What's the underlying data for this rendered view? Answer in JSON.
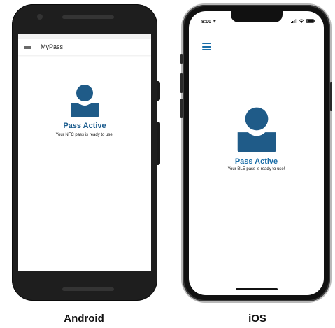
{
  "android": {
    "app_title": "MyPass",
    "pass_title": "Pass Active",
    "pass_subtitle": "Your NFC pass is ready to use!",
    "caption": "Android"
  },
  "ios": {
    "time": "8:00",
    "pass_title": "Pass Active",
    "pass_subtitle": "Your BLE pass is ready to use!",
    "caption": "iOS"
  },
  "icons": {
    "menu": "hamburger-menu-icon",
    "person": "person-icon",
    "location_arrow": "location-arrow-icon",
    "signal": "signal-icon",
    "wifi": "wifi-icon",
    "battery": "battery-icon"
  },
  "colors": {
    "accent_dark": "#1b5c8e",
    "accent_ios": "#1b6ea8",
    "icon_fill": "#1f5b88"
  }
}
